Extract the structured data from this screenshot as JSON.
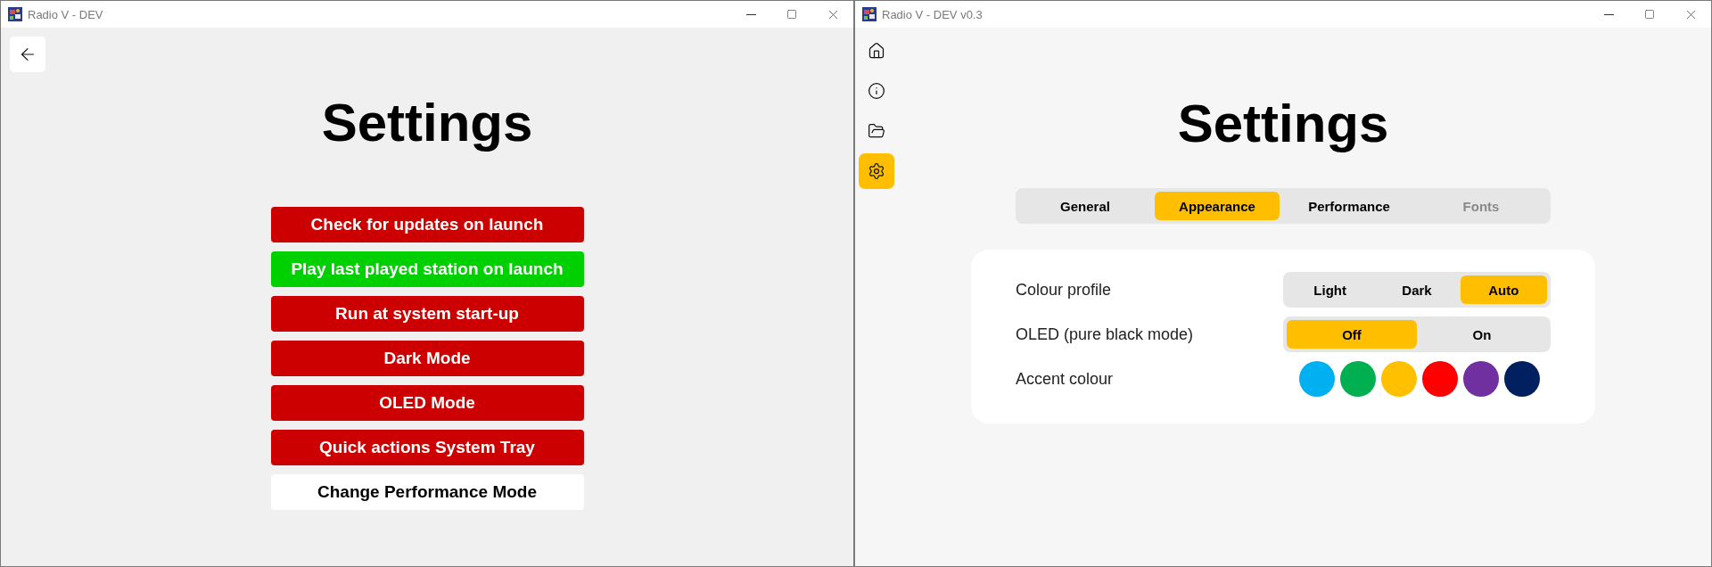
{
  "left_window": {
    "title": "Radio V - DEV",
    "heading": "Settings",
    "options": [
      {
        "kind": "toggle",
        "label": "Check for updates on launch",
        "on": false
      },
      {
        "kind": "toggle",
        "label": "Play last played station on launch",
        "on": true
      },
      {
        "kind": "toggle",
        "label": "Run at system start-up",
        "on": false
      },
      {
        "kind": "toggle",
        "label": "Dark Mode",
        "on": false
      },
      {
        "kind": "toggle",
        "label": "OLED Mode",
        "on": false
      },
      {
        "kind": "toggle",
        "label": "Quick actions System Tray",
        "on": false
      },
      {
        "kind": "action",
        "label": "Change Performance Mode"
      }
    ]
  },
  "right_window": {
    "title": "Radio V - DEV v0.3",
    "sidebar": {
      "items": [
        {
          "selected": false
        },
        {
          "selected": false
        },
        {
          "selected": false
        },
        {
          "selected": true
        }
      ]
    },
    "heading": "Settings",
    "tabs": [
      {
        "label": "General",
        "selected": false,
        "disabled": false
      },
      {
        "label": "Appearance",
        "selected": true,
        "disabled": false
      },
      {
        "label": "Performance",
        "selected": false,
        "disabled": false
      },
      {
        "label": "Fonts",
        "selected": false,
        "disabled": true
      }
    ],
    "rows": [
      {
        "kind": "segmented",
        "label": "Colour profile",
        "options": [
          {
            "label": "Light",
            "selected": false
          },
          {
            "label": "Dark",
            "selected": false
          },
          {
            "label": "Auto",
            "selected": true
          }
        ]
      },
      {
        "kind": "segmented",
        "label": "OLED (pure black mode)",
        "options": [
          {
            "label": "Off",
            "selected": true
          },
          {
            "label": "On",
            "selected": false
          }
        ]
      },
      {
        "kind": "swatches",
        "label": "Accent colour",
        "swatches": [
          {
            "color": "#00b0f0"
          },
          {
            "color": "#00b050"
          },
          {
            "color": "#ffc000"
          },
          {
            "color": "#ff0000"
          },
          {
            "color": "#7030a0"
          },
          {
            "color": "#002060"
          }
        ]
      }
    ]
  }
}
